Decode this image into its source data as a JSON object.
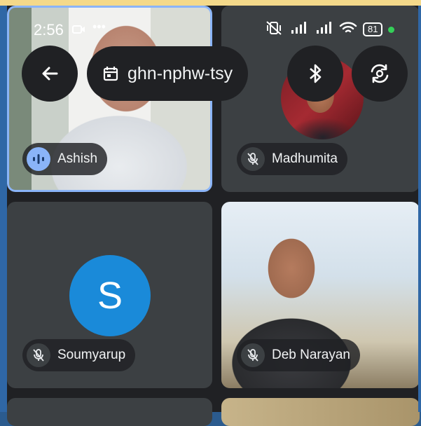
{
  "status_bar": {
    "time": "2:56",
    "battery": "81"
  },
  "meeting": {
    "code": "ghn-nphw-tsy"
  },
  "participants": [
    {
      "name": "Ashish",
      "state": "speaking"
    },
    {
      "name": "Madhumita",
      "state": "muted"
    },
    {
      "name": "Soumyarup",
      "state": "muted",
      "initial": "S"
    },
    {
      "name": "Deb Narayan",
      "state": "muted"
    }
  ],
  "colors": {
    "accent": "#8ab4f8",
    "avatar": "#1a8ad9",
    "tile": "#3c4043",
    "background": "#202124"
  }
}
